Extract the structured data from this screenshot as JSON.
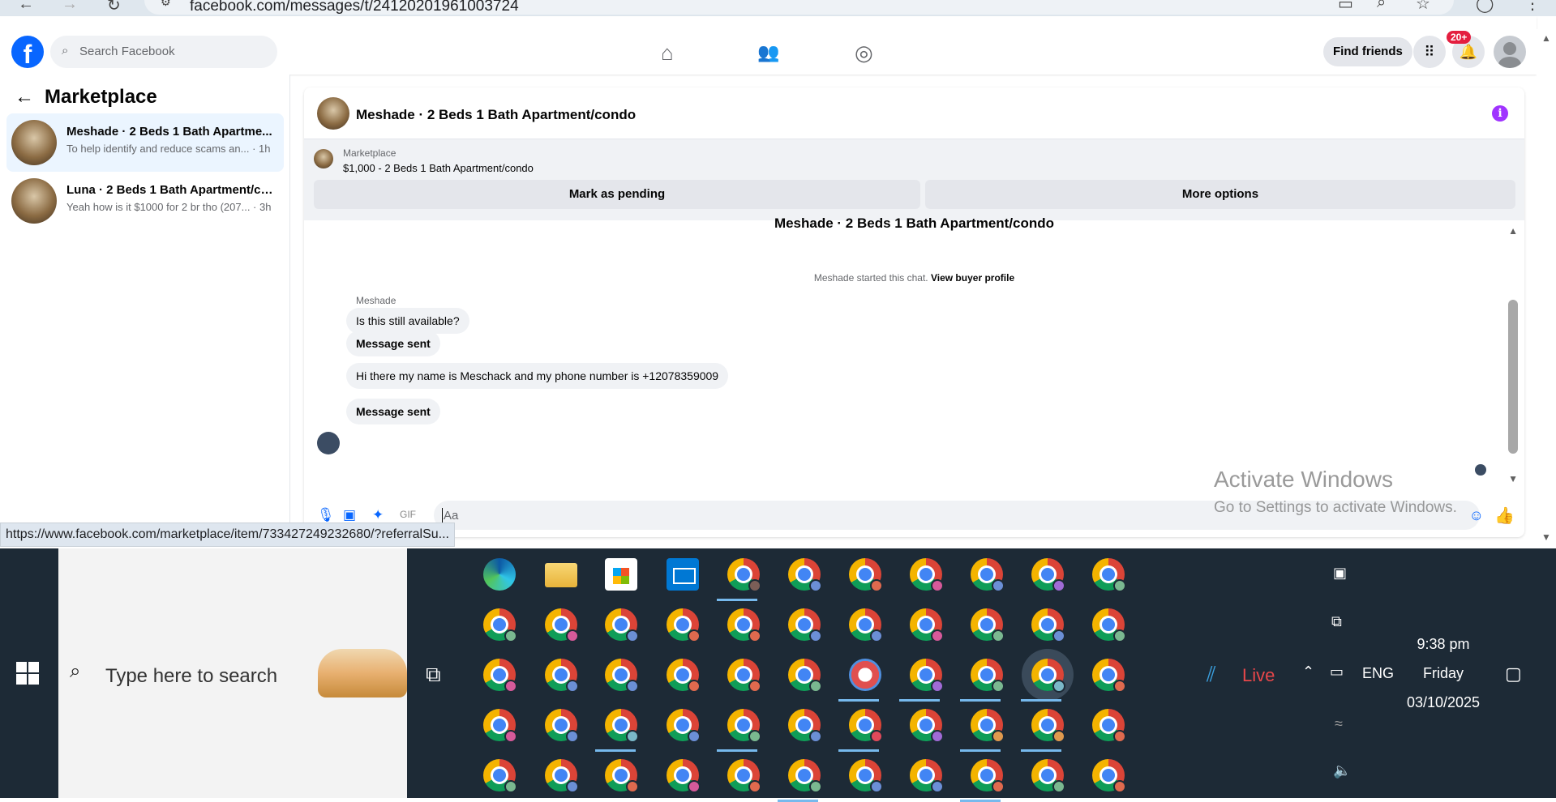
{
  "browser": {
    "url": "facebook.com/messages/t/24120201961003724"
  },
  "header": {
    "logo": "f",
    "search_placeholder": "Search Facebook",
    "find_friends": "Find friends",
    "notifications_badge": "20+",
    "icons": [
      "home-icon",
      "friends-icon",
      "groups-icon",
      "menu-grid-icon",
      "bell-icon"
    ]
  },
  "sidebar": {
    "title": "Marketplace",
    "conversations": [
      {
        "name": "Meshade · 2 Beds 1 Bath Apartme...",
        "snippet": "To help identify and reduce scams an... · 1h",
        "active": true
      },
      {
        "name": "Luna · 2 Beds 1 Bath Apartment/co...",
        "snippet": "Yeah how is it $1000 for 2 br tho (207... · 3h",
        "active": false
      }
    ]
  },
  "chat": {
    "title": "Meshade · 2 Beds 1 Bath Apartment/condo",
    "listing_source": "Marketplace",
    "listing_title": "$1,000 - 2 Beds 1 Bath Apartment/condo",
    "btn_pending": "Mark as pending",
    "btn_more": "More options",
    "cut_title": "Meshade · 2 Beds 1 Bath Apartment/condo",
    "system_text": "Meshade started this chat.",
    "system_link": "View buyer profile",
    "sender": "Meshade",
    "messages": [
      "Is this still available?",
      "Message sent",
      "Hi there my name is Meschack and my phone number is +12078359009",
      "Message sent"
    ],
    "composer_placeholder": "Aa"
  },
  "watermark": {
    "line1": "Activate Windows",
    "line2": "Go to Settings to activate Windows."
  },
  "status_url": "https://www.facebook.com/marketplace/item/733427249232680/?referralSu...",
  "taskbar": {
    "search_placeholder": "Type here to search",
    "live": "Live",
    "lang": "ENG",
    "time": "9:38 pm",
    "day": "Friday",
    "date": "03/10/2025"
  }
}
